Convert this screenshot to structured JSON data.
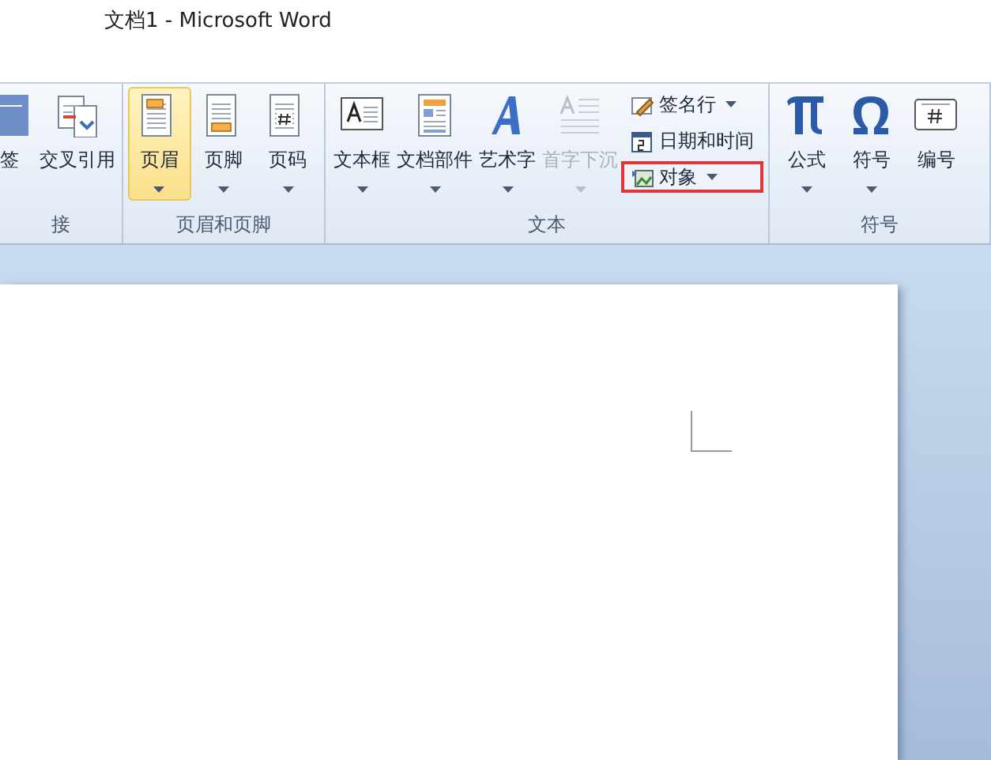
{
  "window": {
    "title": "文档1  -  Microsoft Word"
  },
  "ribbon": {
    "groups": [
      {
        "label": "接",
        "buttons": [
          {
            "kind": "large",
            "label": "签",
            "dropdown": false,
            "selected": false,
            "disabled": false,
            "highlighted": false
          },
          {
            "kind": "large",
            "label": "交叉引用",
            "dropdown": false,
            "selected": false,
            "disabled": false,
            "highlighted": false
          }
        ]
      },
      {
        "label": "页眉和页脚",
        "buttons": [
          {
            "kind": "large",
            "label": "页眉",
            "dropdown": true,
            "selected": true,
            "disabled": false,
            "highlighted": false
          },
          {
            "kind": "large",
            "label": "页脚",
            "dropdown": true,
            "selected": false,
            "disabled": false,
            "highlighted": false
          },
          {
            "kind": "large",
            "label": "页码",
            "dropdown": true,
            "selected": false,
            "disabled": false,
            "highlighted": false
          }
        ]
      },
      {
        "label": "文本",
        "buttons": [
          {
            "kind": "large",
            "label": "文本框",
            "dropdown": true,
            "selected": false,
            "disabled": false,
            "highlighted": false
          },
          {
            "kind": "large",
            "label": "文档部件",
            "dropdown": true,
            "selected": false,
            "disabled": false,
            "highlighted": false
          },
          {
            "kind": "large",
            "label": "艺术字",
            "dropdown": true,
            "selected": false,
            "disabled": false,
            "highlighted": false
          },
          {
            "kind": "large",
            "label": "首字下沉",
            "dropdown": true,
            "selected": false,
            "disabled": true,
            "highlighted": false
          },
          {
            "kind": "small",
            "label": "签名行",
            "dropdown": true,
            "selected": false,
            "disabled": false,
            "highlighted": false
          },
          {
            "kind": "small",
            "label": "日期和时间",
            "dropdown": false,
            "selected": false,
            "disabled": false,
            "highlighted": false
          },
          {
            "kind": "small",
            "label": "对象",
            "dropdown": true,
            "selected": false,
            "disabled": false,
            "highlighted": true
          }
        ]
      },
      {
        "label": "符号",
        "buttons": [
          {
            "kind": "large",
            "label": "公式",
            "dropdown": true,
            "selected": false,
            "disabled": false,
            "highlighted": false
          },
          {
            "kind": "large",
            "label": "符号",
            "dropdown": true,
            "selected": false,
            "disabled": false,
            "highlighted": false
          },
          {
            "kind": "large",
            "label": "编号",
            "dropdown": false,
            "selected": false,
            "disabled": false,
            "highlighted": false
          }
        ]
      }
    ]
  }
}
